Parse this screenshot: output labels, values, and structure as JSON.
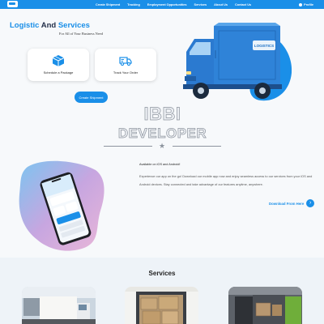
{
  "nav": {
    "links": [
      "Create Shipment",
      "Tracking",
      "Employment Opportunities",
      "Services",
      "About Us",
      "Contact Us"
    ],
    "profile_label": "Profile"
  },
  "hero": {
    "title_accent_1": "Logistic",
    "title_dark": "And",
    "title_accent_2": "Services",
    "subtitle": "For All of Your Business Need",
    "cards": [
      {
        "label": "Schedule a Package",
        "icon": "package-box-icon"
      },
      {
        "label": "Track Your Order",
        "icon": "delivery-truck-icon"
      }
    ],
    "create_button": "Create Shipment",
    "truck_sign": "LOGISTICS"
  },
  "watermark": {
    "line1": "IBBI",
    "line2": "DEVELOPER"
  },
  "app": {
    "availability": "Available on iOS and Android!",
    "description": "Experience our app on the go! Download our mobile app now and enjoy seamless access to our services from your iOS and Android devices. Stay connected and take advantage of our features anytime, anywhere.",
    "download_label": "Download From Here"
  },
  "services": {
    "title": "Services"
  },
  "colors": {
    "accent": "#1a8fe8",
    "dark": "#24304a",
    "blob_pink": "#e9b6d8",
    "blob_blue": "#7cc4f0"
  }
}
